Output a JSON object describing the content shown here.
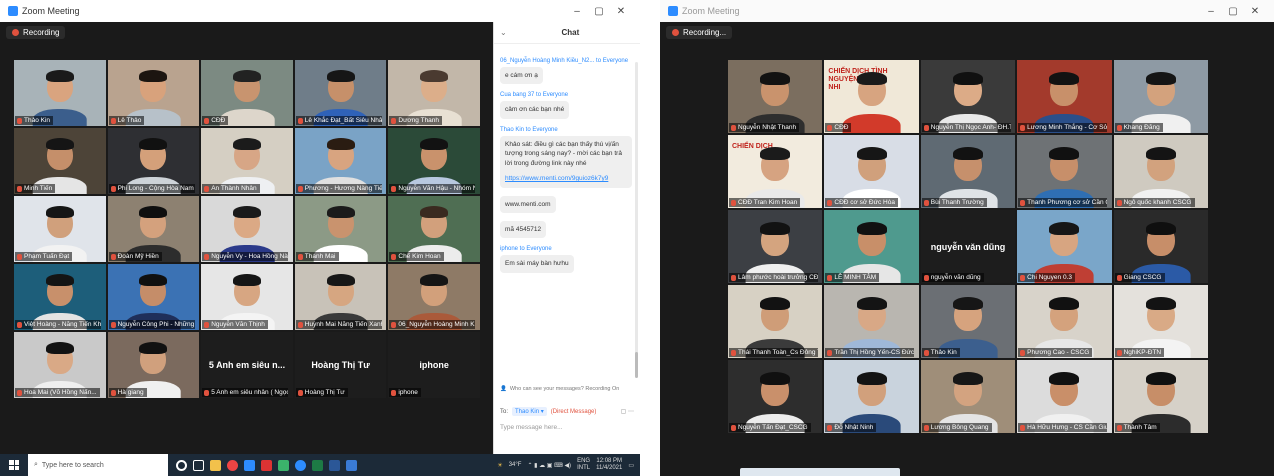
{
  "left_window": {
    "title": "Zoom Meeting",
    "recording_label": "Recording",
    "controls": [
      "–",
      "▢",
      "✕"
    ],
    "participants": [
      {
        "name": "Thảo Kin",
        "active": true,
        "bg": "#a8b3b8",
        "skin": "#d9a47f",
        "shirt": "#3b5e8c",
        "hair": "#1a1a1a"
      },
      {
        "name": "Lê Thảo",
        "bg": "#b9a38f",
        "skin": "#d8a27c",
        "shirt": "#b7c1c9",
        "hair": "#1c1510"
      },
      {
        "name": "CĐĐ",
        "bg": "#7c8a82",
        "skin": "#c8946f",
        "shirt": "#ddd6cb",
        "hair": "#222"
      },
      {
        "name": "Lê Khắc Đạt_Bất Siêu Nhân",
        "bg": "#6f7d89",
        "skin": "#c6906a",
        "shirt": "#2f62b8",
        "hair": "#161616"
      },
      {
        "name": "Dương Thanh",
        "bg": "#c2b7a9",
        "skin": "#dcae8a",
        "shirt": "#e8e0d3",
        "hair": "#4a3a30"
      },
      {
        "name": "Minh Tiến",
        "bg": "#4d4438",
        "skin": "#c58f6a",
        "shirt": "#e5e5e5",
        "hair": "#151515"
      },
      {
        "name": "Phi Long - Cộng Hòa Nam",
        "bg": "#2e2f33",
        "skin": "#d4a07a",
        "shirt": "#cdd3d8",
        "hair": "#111"
      },
      {
        "name": "An Thành Nhân",
        "bg": "#d5cfc3",
        "skin": "#d7a686",
        "shirt": "#eef0f2",
        "hair": "#1b1b1b"
      },
      {
        "name": "Phương - Hương Nàng Tiến...",
        "bg": "#7aa3c6",
        "skin": "#d8a480",
        "shirt": "#e0e0e0",
        "hair": "#2a1c12"
      },
      {
        "name": "Nguyễn Văn Hậu - Nhóm Nh...",
        "bg": "#2b4a38",
        "skin": "#c9926c",
        "shirt": "#b8c8e0",
        "hair": "#121212"
      },
      {
        "name": "Phạm Tuấn Đạt",
        "bg": "#e0e4ea",
        "skin": "#d0a07c",
        "shirt": "#f2f2f2",
        "hair": "#161616"
      },
      {
        "name": "Đoàn Mỹ Hiền",
        "bg": "#8d8171",
        "skin": "#d4a17d",
        "shirt": "#2d2d2d",
        "hair": "#0f0f0f"
      },
      {
        "name": "Nguyễn Vy - Hoa Hồng Nà...",
        "bg": "#d9d9d9",
        "skin": "#dba985",
        "shirt": "#2b3a8a",
        "hair": "#1a1a1a"
      },
      {
        "name": "Thanh Mai",
        "bg": "#8c9a86",
        "skin": "#c9936e",
        "shirt": "#ffffff",
        "hair": "#1b1b1b"
      },
      {
        "name": "Chế Kim Hoan",
        "bg": "#4f6e53",
        "skin": "#d2a07c",
        "shirt": "#ececec",
        "hair": "#3a2a20"
      },
      {
        "name": "Việt Hoàng - Năng Tiến Kh...",
        "bg": "#1d5e7a",
        "skin": "#c8906b",
        "shirt": "#e3e3e3",
        "hair": "#141414"
      },
      {
        "name": "Nguyễn Công Phi - Những Nă...",
        "bg": "#3b72b4",
        "skin": "#c58d69",
        "shirt": "#1f2f5a",
        "hair": "#101010"
      },
      {
        "name": "Nguyễn Văn Thịnh",
        "bg": "#e6e6e6",
        "skin": "#d7a682",
        "shirt": "#f4f4f4",
        "hair": "#151515"
      },
      {
        "name": "Huỳnh Mai Năng Tiến Xanh",
        "bg": "#c8c2b8",
        "skin": "#d6a681",
        "shirt": "#3a3a3a",
        "hair": "#171717"
      },
      {
        "name": "06_Nguyễn Hoàng Minh Ki...",
        "bg": "#8e7a66",
        "skin": "#d2a07b",
        "shirt": "#aa5a3a",
        "hair": "#151515"
      },
      {
        "name": "Hoa Mai (Võ Hồng Nấn...",
        "bg": "#c9c9c9",
        "skin": "#d9a986",
        "shirt": "#efefef",
        "hair": "#121212"
      },
      {
        "name": "Hà giang",
        "bg": "#7b6a5e",
        "skin": "#d0a07d",
        "shirt": "#f0f0f0",
        "hair": "#111"
      },
      {
        "name": "5 Anh em siêu nhân ( Ngọc...",
        "big": "5 Anh em siêu n..."
      },
      {
        "name": "Hoàng Thị Tư",
        "big": "Hoàng Thị Tư"
      },
      {
        "name": "iphone",
        "big": "iphone"
      }
    ],
    "chat": {
      "title": "Chat",
      "messages": [
        {
          "from": "06_Nguyễn Hoàng Minh Kiều_N2... to Everyone",
          "text": "e cám ơn ạ"
        },
        {
          "from": "Cua bang 37 to Everyone",
          "text": "cảm ơn các bạn nhé"
        },
        {
          "from": "Thao Kin to Everyone",
          "text": "Khảo sát: điều gì các bạn thấy thú vị/ấn tượng trong sáng nay? - mời các bạn trả lời trong đường link này nhé",
          "link": "https://www.menti.com/9guioz6k7y9"
        },
        {
          "from": "",
          "text": "www.menti.com"
        },
        {
          "from": "",
          "text": "mã 4545712"
        },
        {
          "from": "iphone to Everyone",
          "text": "Em sài máy bàn hưhu"
        }
      ],
      "who_can_see": "Who can see your messages? Recording On",
      "to_label": "To:",
      "to_value": "Thao Kin ▾",
      "direct_label": "(Direct Message)",
      "input_placeholder": "Type message here..."
    },
    "taskbar": {
      "search_placeholder": "Type here to search",
      "weather": "34°F",
      "lang_top": "ENG",
      "lang_bottom": "INTL",
      "time": "12:08 PM",
      "date": "11/4/2021"
    }
  },
  "right_window": {
    "title": "Zoom Meeting",
    "recording_label": "Recording...",
    "controls": [
      "–",
      "▢",
      "✕"
    ],
    "participants": [
      {
        "name": "Nguyễn Nhật Thanh",
        "bg": "#7b6e5f",
        "skin": "#c9936d",
        "shirt": "#2e2e2e",
        "hair": "#121212"
      },
      {
        "name": "CĐĐ",
        "active": true,
        "poster": "CHIẾN DỊCH TÌNH NGUYỆN THIẾU NHI",
        "bg": "#f0e8d8",
        "skin": "#d7a480",
        "shirt": "#d23a2a",
        "hair": "#1a1a1a"
      },
      {
        "name": "Nguyễn Thị Ngọc Anh- ĐH.TC...",
        "bg": "#3a3a3a",
        "skin": "#dcab87",
        "shirt": "#e8e8e8",
        "hair": "#101010"
      },
      {
        "name": "Lương Minh Thắng - Cơ Sở Cầ...",
        "bg": "#a33a2c",
        "skin": "#c8906a",
        "shirt": "#2a4f8a",
        "hair": "#121212"
      },
      {
        "name": "Khang Đăng",
        "bg": "#8e9aa4",
        "skin": "#d3a27d",
        "shirt": "#f0f0f0",
        "hair": "#151515"
      },
      {
        "name": "CĐĐ Tran Kim Hoan",
        "poster": "CHIẾN DỊCH",
        "bg": "#f2ebde",
        "skin": "#d6a381",
        "shirt": "#e9e9e9",
        "hair": "#1b1b1b"
      },
      {
        "name": "CĐĐ cơ sở Đức Hòa",
        "bg": "#d8dde6",
        "skin": "#d0a07c",
        "shirt": "#ffffff",
        "hair": "#161616"
      },
      {
        "name": "Bùi Thanh Trường",
        "bg": "#5f6a73",
        "skin": "#c6906c",
        "shirt": "#dfe3e6",
        "hair": "#121212"
      },
      {
        "name": "Thanh Phương cơ sở Cần Giuộc",
        "bg": "#6e7275",
        "skin": "#c78f6a",
        "shirt": "#2f6fb4",
        "hair": "#111"
      },
      {
        "name": "Ngô quốc khanh CSCG",
        "bg": "#cfcac0",
        "skin": "#d2a27e",
        "shirt": "#f1f1f1",
        "hair": "#141414"
      },
      {
        "name": "Lâm phước hoài trưởng CĐ lo...",
        "bg": "#3c3f44",
        "skin": "#d4a47f",
        "shirt": "#efefef",
        "hair": "#121212"
      },
      {
        "name": "LÊ MINH TÂM",
        "bg": "#4f9a8e",
        "skin": "#c88f69",
        "shirt": "#e6e6e6",
        "hair": "#111"
      },
      {
        "name": "nguyễn văn dũng",
        "big": "nguyễn văn dũng"
      },
      {
        "name": "Chi Nguyen 0.3",
        "bg": "#7aa6c9",
        "skin": "#d7a581",
        "shirt": "#bf3f34",
        "hair": "#161616"
      },
      {
        "name": "Giang CSCG",
        "bg": "#2a2a2a",
        "skin": "#c78e69",
        "shirt": "#2b5aa6",
        "hair": "#0f0f0f"
      },
      {
        "name": "Thái Thanh Toàn_Cs Đông Th...",
        "bg": "#d7d1c4",
        "skin": "#cf9d78",
        "shirt": "#3b3b3b",
        "hair": "#121212"
      },
      {
        "name": "Trần Thị Hồng Yến-CS Đức Hòa",
        "bg": "#b9b6b0",
        "skin": "#d8a886",
        "shirt": "#9fb8d8",
        "hair": "#141414"
      },
      {
        "name": "Thảo Kin",
        "bg": "#6b6f74",
        "skin": "#d6a37e",
        "shirt": "#3c5f8e",
        "hair": "#161616"
      },
      {
        "name": "Phương Cao - CSCG",
        "bg": "#d8d3ca",
        "skin": "#d4a27d",
        "shirt": "#e7e7e7",
        "hair": "#111"
      },
      {
        "name": "NghiKP-ĐTN",
        "bg": "#e4e1dc",
        "skin": "#d9aa86",
        "shirt": "#f3f3f3",
        "hair": "#131313"
      },
      {
        "name": "Nguyễn Tấn Đạt_CSCG",
        "bg": "#2d2d2d",
        "skin": "#c9906b",
        "shirt": "#ececec",
        "hair": "#101010"
      },
      {
        "name": "Đỗ Nhật Ninh",
        "bg": "#c9d3dd",
        "skin": "#d1a07c",
        "shirt": "#2a4a7a",
        "hair": "#131313"
      },
      {
        "name": "Lương Bông Quang",
        "bg": "#9f8e79",
        "skin": "#d3a380",
        "shirt": "#e4e4e4",
        "hair": "#171717"
      },
      {
        "name": "Hà Hữu Hưng - CS Cần Giuộc",
        "bg": "#dcdcdc",
        "skin": "#c98f69",
        "shirt": "#f0f0f0",
        "hair": "#111"
      },
      {
        "name": "Thành Tâm",
        "bg": "#d6d1c8",
        "skin": "#c78e68",
        "shirt": "#2c2c2c",
        "hair": "#101010"
      }
    ]
  }
}
